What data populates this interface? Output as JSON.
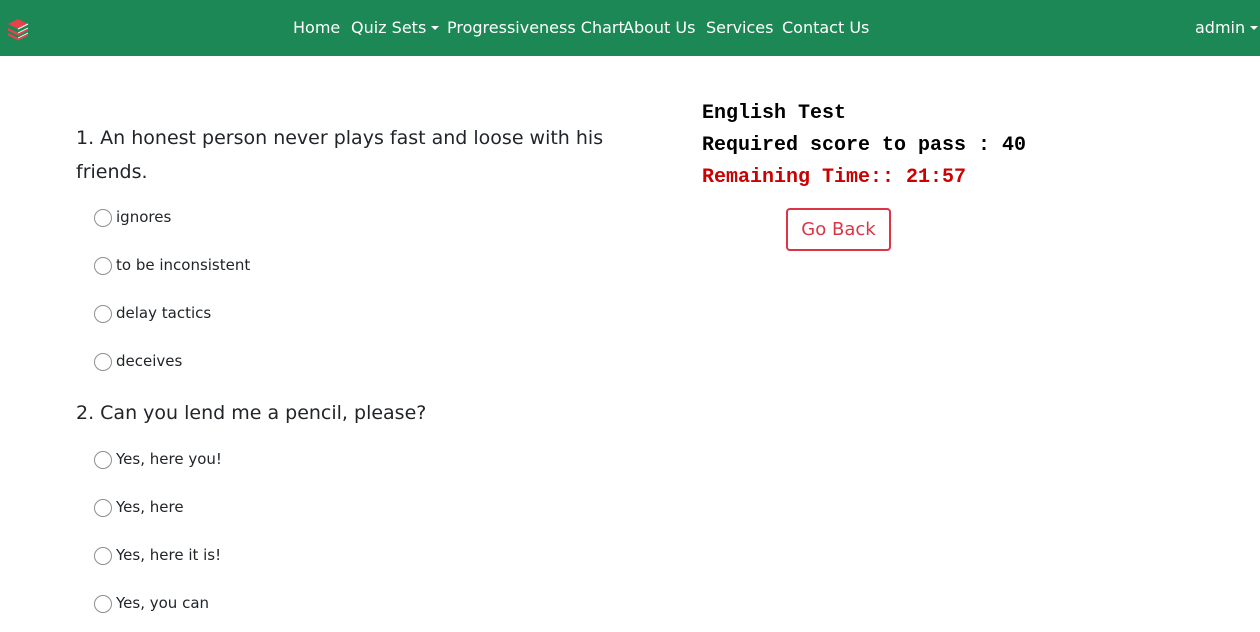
{
  "navbar": {
    "brand_icon": "stacked-books-icon",
    "background": "#1b8856",
    "links": {
      "home": "Home",
      "quiz_sets": "Quiz Sets",
      "progress_chart": "Progressiveness Chart",
      "about": "About Us",
      "services": "Services",
      "contact": "Contact Us"
    },
    "user": "admin"
  },
  "quiz": {
    "questions": [
      {
        "text": "1. An honest person never plays fast and loose with his friends.",
        "options": [
          "ignores",
          "to be inconsistent",
          "delay tactics",
          "deceives"
        ]
      },
      {
        "text": "2. Can you lend me a pencil, please?",
        "options": [
          "Yes, here you!",
          "Yes, here",
          "Yes, here it is!",
          "Yes, you can"
        ]
      }
    ]
  },
  "test_info": {
    "title": "English Test",
    "required_score": "Required score to pass : 40",
    "remaining_time": "Remaining Time:: 21:57",
    "timer_color": "#cc0000",
    "go_back_label": "Go Back",
    "go_back_color": "#dc3545"
  }
}
